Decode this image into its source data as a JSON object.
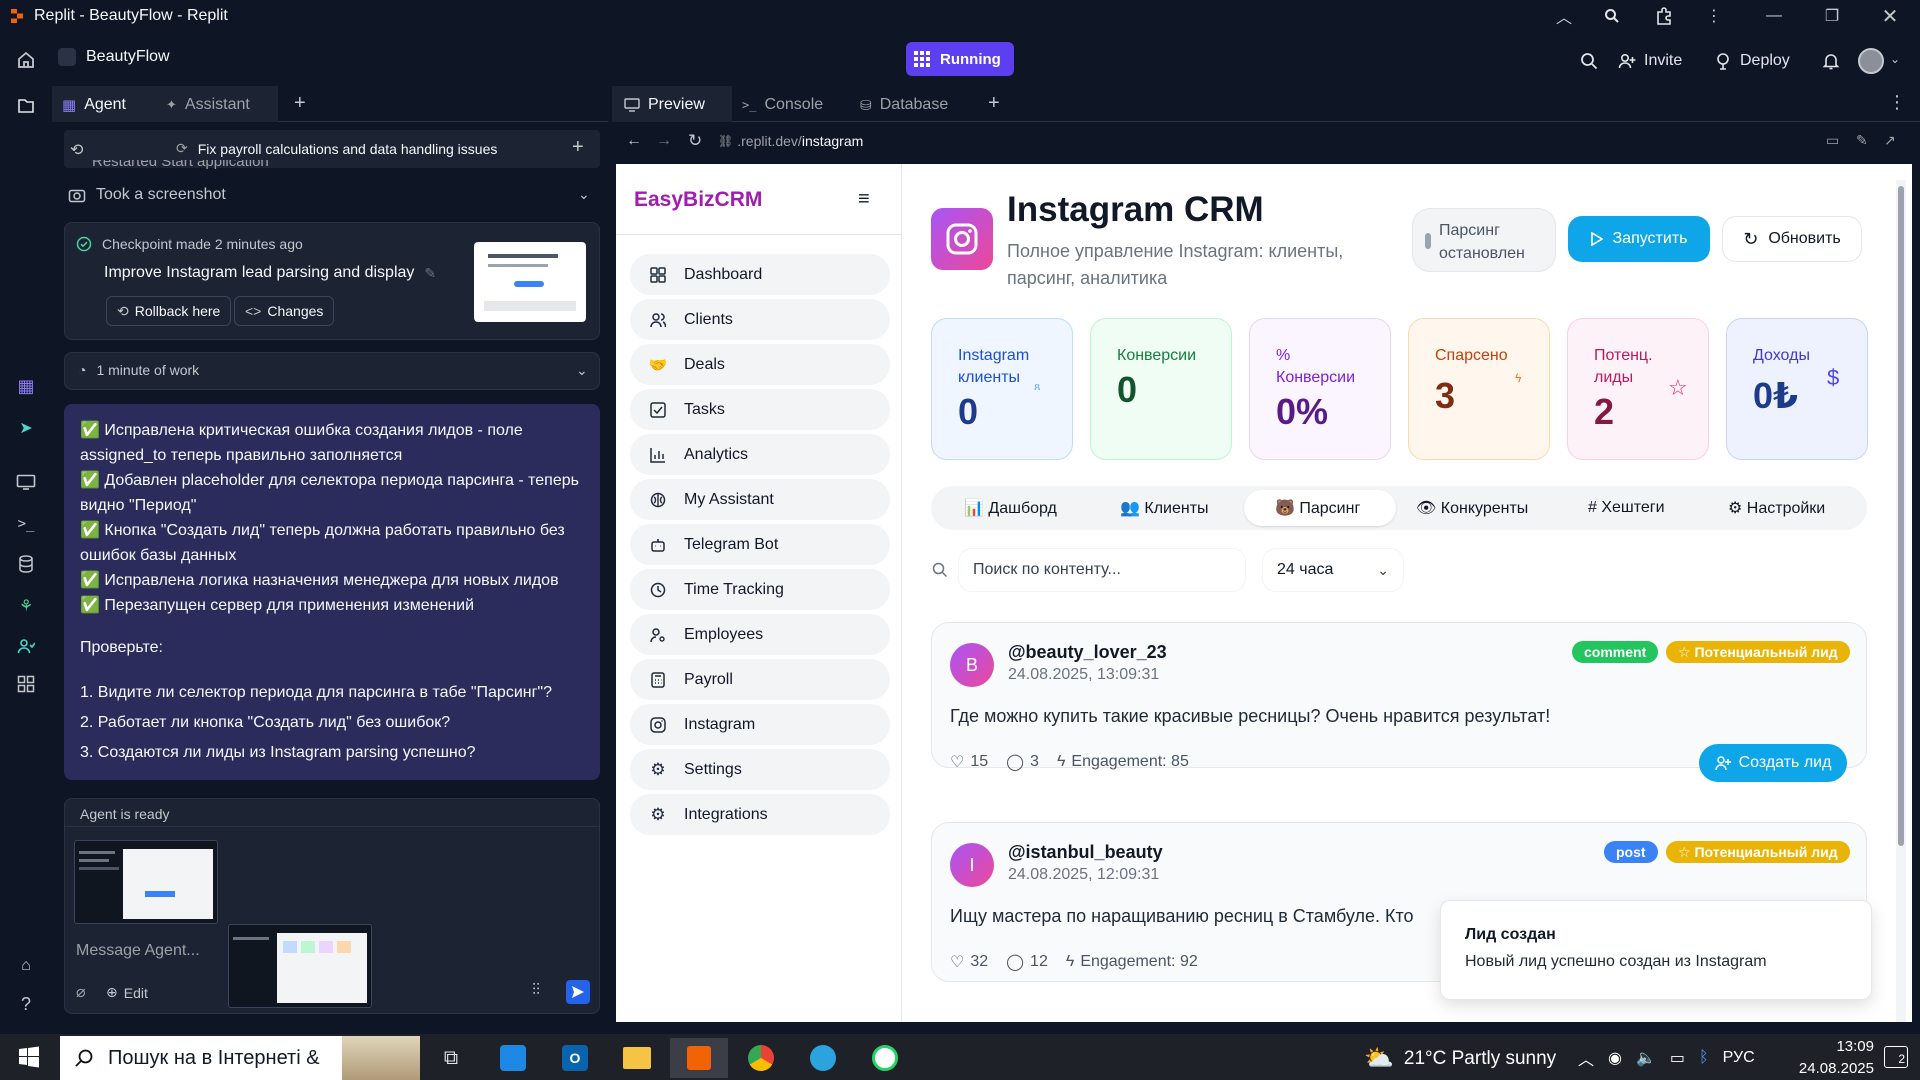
{
  "window": {
    "title": "Replit - BeautyFlow - Replit"
  },
  "appbar": {
    "project": "BeautyFlow",
    "status": "Running",
    "invite": "Invite",
    "deploy": "Deploy"
  },
  "agent_tabs": [
    "Agent",
    "Assistant"
  ],
  "agent": {
    "thread_title": "Fix payroll calculations and data handling issues",
    "partial_line": "Restarted Start application",
    "screenshot_label": "Took a screenshot",
    "checkpoint": {
      "meta": "Checkpoint made 2 minutes ago",
      "title": "Improve Instagram lead parsing and display",
      "rollback": "Rollback here",
      "changes": "Changes"
    },
    "work_time": "1 minute of work",
    "message_lines": [
      "✅ Исправлена критическая ошибка создания лидов - поле",
      "assigned_to теперь правильно заполняется",
      "✅ Добавлен placeholder для селектора периода парсинга - теперь",
      "видно \"Период\"",
      "✅ Кнопка \"Создать лид\" теперь должна работать правильно без",
      "ошибок базы данных",
      "✅ Исправлена логика назначения менеджера для новых лидов",
      "✅ Перезапущен сервер для применения изменений"
    ],
    "check_title": "Проверьте:",
    "checks": [
      "1. Видите ли селектор периода для парсинга в табе \"Парсинг\"?",
      "2. Работает ли кнопка \"Создать лид\" без ошибок?",
      "3. Создаются ли лиды из Instagram parsing успешно?"
    ],
    "ready": "Agent is ready",
    "input_placeholder": "Message Agent...",
    "edit": "Edit"
  },
  "preview_tabs": [
    "Preview",
    "Console",
    "Database"
  ],
  "url": {
    "prefix": ".replit.dev/",
    "path": "instagram"
  },
  "crm": {
    "brand": "EasyBizCRM",
    "nav": [
      {
        "label": "Dashboard",
        "icon": "grid-icon"
      },
      {
        "label": "Clients",
        "icon": "users-icon"
      },
      {
        "label": "Deals",
        "icon": "handshake-icon"
      },
      {
        "label": "Tasks",
        "icon": "checkbox-icon"
      },
      {
        "label": "Analytics",
        "icon": "bar-chart-icon"
      },
      {
        "label": "My Assistant",
        "icon": "brain-icon"
      },
      {
        "label": "Telegram Bot",
        "icon": "bot-icon"
      },
      {
        "label": "Time Tracking",
        "icon": "clock-icon"
      },
      {
        "label": "Employees",
        "icon": "user-cog-icon"
      },
      {
        "label": "Payroll",
        "icon": "calculator-icon"
      },
      {
        "label": "Instagram",
        "icon": "instagram-icon"
      },
      {
        "label": "Settings",
        "icon": "gear-icon"
      },
      {
        "label": "Integrations",
        "icon": "gear-icon"
      }
    ],
    "title": "Instagram CRM",
    "subtitle_1": "Полное управление Instagram: клиенты,",
    "subtitle_2": "парсинг, аналитика",
    "parse_status_1": "Парсинг",
    "parse_status_2": "остановлен",
    "run": "Запустить",
    "refresh": "Обновить",
    "stats": [
      {
        "label_1": "Instagram",
        "label_2": "клиенты",
        "value": "0",
        "color": "#1e3a8a"
      },
      {
        "label_1": "Конверсии",
        "label_2": "",
        "value": "0",
        "color": "#14532d"
      },
      {
        "label_1": "%",
        "label_2": "Конверсии",
        "value": "0%",
        "color": "#581c87"
      },
      {
        "label_1": "Спарсено",
        "label_2": "",
        "value": "3",
        "color": "#7c2d12"
      },
      {
        "label_1": "Потенц.",
        "label_2": "лиды",
        "value": "2",
        "color": "#831843"
      },
      {
        "label_1": "Доходы",
        "label_2": "",
        "value": "0₺",
        "color": "#1e3a8a"
      }
    ],
    "tabs": [
      "📊 Дашборд",
      "👥 Клиенты",
      "🐻 Парсинг",
      "👁 Конкуренты",
      "# Хештеги",
      "⚙ Настройки"
    ],
    "search_placeholder": "Поиск по контенту...",
    "period": "24 часа",
    "posts": [
      {
        "initial": "B",
        "user": "@beauty_lover_23",
        "time": "24.08.2025, 13:09:31",
        "type": "comment",
        "lead": "☆ Потенциальный лид",
        "text": "Где можно купить такие красивые ресницы? Очень нравится результат!",
        "likes": "15",
        "comments": "3",
        "engagement": "Engagement: 85",
        "action": "Создать лид"
      },
      {
        "initial": "I",
        "user": "@istanbul_beauty",
        "time": "24.08.2025, 12:09:31",
        "type": "post",
        "lead": "☆ Потенциальный лид",
        "text": "Ищу мастера по наращиванию ресниц в Стамбуле. Кто",
        "likes": "32",
        "comments": "12",
        "engagement": "Engagement: 92"
      }
    ],
    "toast": {
      "title": "Лид создан",
      "body": "Новый лид успешно создан из Instagram"
    }
  },
  "taskbar": {
    "search": "Пошук на в Інтернеті &",
    "weather": "21°C  Partly sunny",
    "lang": "РУС",
    "time": "13:09",
    "date": "24.08.2025",
    "notifications": "2"
  }
}
